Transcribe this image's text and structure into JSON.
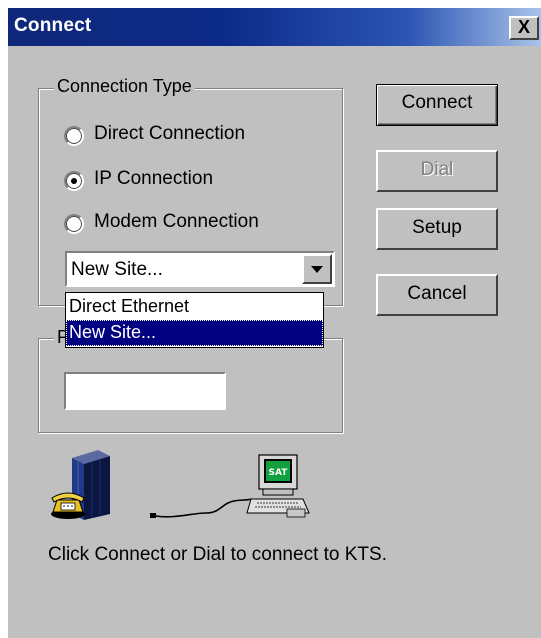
{
  "window": {
    "title": "Connect",
    "close_label": "X"
  },
  "connection_type": {
    "legend": "Connection Type",
    "options": [
      {
        "label": "Direct Connection",
        "checked": false
      },
      {
        "label": "IP Connection",
        "checked": true
      },
      {
        "label": "Modem Connection",
        "checked": false
      }
    ],
    "site_combo": {
      "value": "New Site...",
      "options": [
        "Direct Ethernet",
        "New Site..."
      ],
      "highlighted": "New Site..."
    }
  },
  "second_group": {
    "legend": "P",
    "input_value": ""
  },
  "buttons": {
    "connect": "Connect",
    "dial": "Dial",
    "setup": "Setup",
    "cancel": "Cancel"
  },
  "icons": [
    "telephone-server-icon",
    "serial-cable-icon",
    "sat-terminal-icon"
  ],
  "terminal_screen_text": "SAT",
  "status_text": "Click Connect or Dial to connect to KTS.",
  "colors": {
    "title_bar": "#0c2a88",
    "face": "#c0c0c0",
    "selection": "#000080"
  }
}
